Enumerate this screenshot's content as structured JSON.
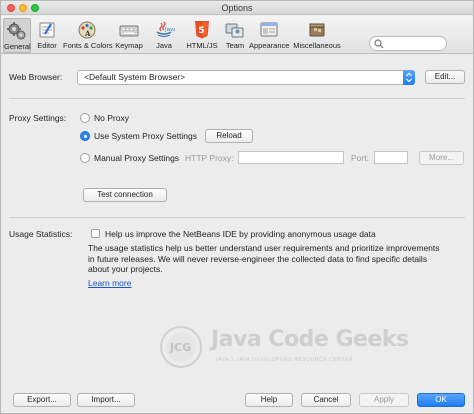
{
  "window": {
    "title": "Options"
  },
  "toolbar": {
    "items": [
      {
        "label": "General",
        "icon": "gear-icon"
      },
      {
        "label": "Editor",
        "icon": "editor-icon"
      },
      {
        "label": "Fonts & Colors",
        "icon": "fonts-colors-icon"
      },
      {
        "label": "Keymap",
        "icon": "keymap-icon"
      },
      {
        "label": "Java",
        "icon": "java-icon"
      },
      {
        "label": "HTML/JS",
        "icon": "html5-icon"
      },
      {
        "label": "Team",
        "icon": "team-icon"
      },
      {
        "label": "Appearance",
        "icon": "appearance-icon"
      },
      {
        "label": "Miscellaneous",
        "icon": "miscellaneous-icon"
      }
    ],
    "active": "General",
    "search": {
      "value": "",
      "placeholder": ""
    }
  },
  "web_browser": {
    "label": "Web Browser:",
    "selected": "<Default System Browser>",
    "edit_label": "Edit..."
  },
  "proxy": {
    "label": "Proxy Settings:",
    "options": [
      "No Proxy",
      "Use System Proxy Settings",
      "Manual Proxy Settings"
    ],
    "selected": "Use System Proxy Settings",
    "reload_label": "Reload",
    "http_proxy_label": "HTTP Proxy:",
    "http_proxy_value": "",
    "port_label": "Port:",
    "port_value": "",
    "more_label": "More...",
    "test_label": "Test connection"
  },
  "usage": {
    "label": "Usage Statistics:",
    "checkbox_label": "Help us improve the NetBeans IDE by providing anonymous usage data",
    "checked": false,
    "description_lines": [
      "The usage statistics help us better understand user requirements and prioritize improvements",
      "in future releases. We will never reverse-engineer the collected data to find specific details",
      "about your projects."
    ],
    "learn_more": "Learn more"
  },
  "watermark": {
    "logo_text": "JCG",
    "title": "Java Code Geeks",
    "subtitle": "JAVA 2 JAVA DEVELOPERS RESOURCE CENTER"
  },
  "footer": {
    "export_label": "Export...",
    "import_label": "Import...",
    "help_label": "Help",
    "cancel_label": "Cancel",
    "apply_label": "Apply",
    "ok_label": "OK"
  },
  "colors": {
    "accent": "#1d7ff4",
    "link": "#1a55c9",
    "html5": "#e44d26",
    "java": "#3a75b0"
  }
}
